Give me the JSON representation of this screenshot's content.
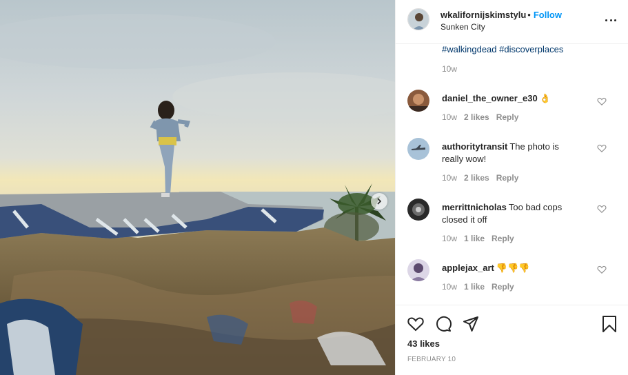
{
  "post": {
    "username": "wkalifornijskimstylu",
    "separator": "•",
    "follow_label": "Follow",
    "location": "Sunken City",
    "more_icon": "more-horizontal-icon"
  },
  "caption": {
    "hashtags": "#walkingdead #discoverplaces",
    "time": "10w"
  },
  "comments": [
    {
      "username": "daniel_the_owner_e30",
      "text": "👌",
      "time": "10w",
      "likes": "2 likes",
      "reply": "Reply"
    },
    {
      "username": "authoritytransit",
      "text": "The photo is really wow!",
      "time": "10w",
      "likes": "2 likes",
      "reply": "Reply"
    },
    {
      "username": "merrittnicholas",
      "text": "Too bad cops closed it off",
      "time": "10w",
      "likes": "1 like",
      "reply": "Reply"
    },
    {
      "username": "applejax_art",
      "text": "👎👎👎",
      "time": "10w",
      "likes": "1 like",
      "reply": "Reply"
    }
  ],
  "footer": {
    "likes": "43 likes",
    "date": "FEBRUARY 10"
  },
  "colors": {
    "link_blue": "#0095f6",
    "hashtag": "#00376b",
    "muted": "#8e8e8e",
    "text": "#262626"
  }
}
